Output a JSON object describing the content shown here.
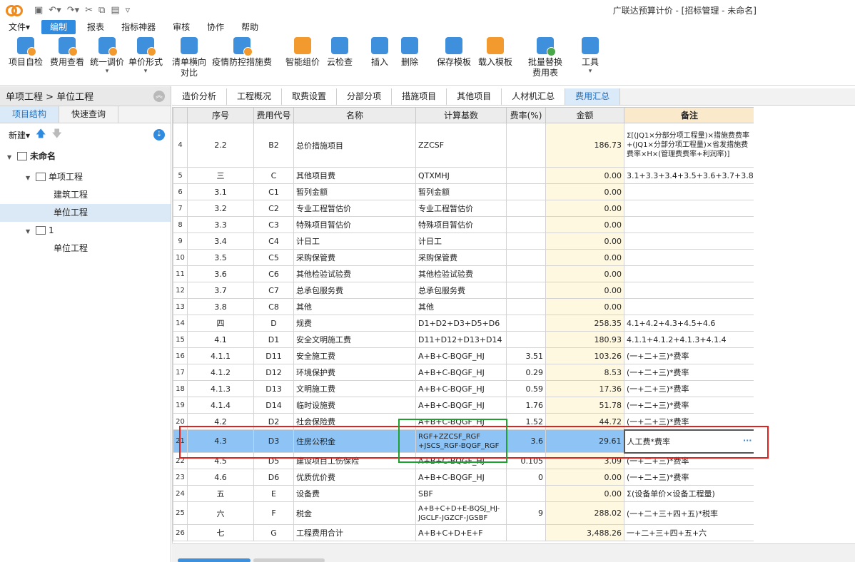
{
  "window": {
    "title": "广联达预算计价 - [招标管理 - 未命名]"
  },
  "menus": [
    "文件▾",
    "编制",
    "报表",
    "指标神器",
    "审核",
    "协作",
    "帮助"
  ],
  "ribbon": [
    {
      "label": "项目自检",
      "icon": "check-doc-icon"
    },
    {
      "label": "费用查看",
      "icon": "fee-view-icon"
    },
    {
      "label": "统一调价",
      "icon": "price-adjust-icon"
    },
    {
      "label": "单价形式",
      "icon": "unit-price-icon"
    },
    {
      "label": "清单横向\n对比",
      "icon": "compare-icon"
    },
    {
      "label": "疫情防控措施费",
      "icon": "epidemic-fee-icon"
    },
    {
      "label": "智能组价",
      "icon": "smart-price-icon"
    },
    {
      "label": "云检查",
      "icon": "cloud-check-icon"
    },
    {
      "label": "插入",
      "icon": "insert-icon"
    },
    {
      "label": "删除",
      "icon": "delete-icon"
    },
    {
      "label": "保存模板",
      "icon": "save-template-icon"
    },
    {
      "label": "载入模板",
      "icon": "load-template-icon"
    },
    {
      "label": "批量替换\n费用表",
      "icon": "batch-replace-icon"
    },
    {
      "label": "工具",
      "icon": "tools-icon"
    }
  ],
  "left": {
    "breadcrumb": "单项工程 > 单位工程",
    "tabs": [
      "项目结构",
      "快速查询"
    ],
    "new_label": "新建",
    "tree": [
      "未命名",
      "单项工程",
      "建筑工程",
      "单位工程",
      "1",
      "单位工程"
    ]
  },
  "tabs": [
    "造价分析",
    "工程概况",
    "取费设置",
    "分部分项",
    "措施项目",
    "其他项目",
    "人材机汇总",
    "费用汇总"
  ],
  "table": {
    "headers": [
      "",
      "序号",
      "费用代号",
      "名称",
      "计算基数",
      "费率(%)",
      "金额",
      "备注"
    ],
    "rows": [
      {
        "n": "4",
        "seq": "2.2",
        "code": "B2",
        "name": "总价措施项目",
        "base": "ZZCSF",
        "rate": "",
        "amt": "186.73",
        "note": "Σ[(JQ1×分部分项工程量)×措施费费率+(JQ1×分部分项工程量)×省发措施费费率×H×(管理费费率+利润率)]"
      },
      {
        "n": "5",
        "seq": "三",
        "code": "C",
        "name": "其他项目费",
        "base": "QTXMHJ",
        "rate": "",
        "amt": "0.00",
        "note": "3.1+3.3+3.4+3.5+3.6+3.7+3.8"
      },
      {
        "n": "6",
        "seq": "3.1",
        "code": "C1",
        "name": "暂列金额",
        "base": "暂列金额",
        "rate": "",
        "amt": "0.00",
        "note": ""
      },
      {
        "n": "7",
        "seq": "3.2",
        "code": "C2",
        "name": "专业工程暂估价",
        "base": "专业工程暂估价",
        "rate": "",
        "amt": "0.00",
        "note": ""
      },
      {
        "n": "8",
        "seq": "3.3",
        "code": "C3",
        "name": "特殊项目暂估价",
        "base": "特殊项目暂估价",
        "rate": "",
        "amt": "0.00",
        "note": ""
      },
      {
        "n": "9",
        "seq": "3.4",
        "code": "C4",
        "name": "计日工",
        "base": "计日工",
        "rate": "",
        "amt": "0.00",
        "note": ""
      },
      {
        "n": "10",
        "seq": "3.5",
        "code": "C5",
        "name": "采购保管费",
        "base": "采购保管费",
        "rate": "",
        "amt": "0.00",
        "note": ""
      },
      {
        "n": "11",
        "seq": "3.6",
        "code": "C6",
        "name": "其他检验试验费",
        "base": "其他检验试验费",
        "rate": "",
        "amt": "0.00",
        "note": ""
      },
      {
        "n": "12",
        "seq": "3.7",
        "code": "C7",
        "name": "总承包服务费",
        "base": "总承包服务费",
        "rate": "",
        "amt": "0.00",
        "note": ""
      },
      {
        "n": "13",
        "seq": "3.8",
        "code": "C8",
        "name": "其他",
        "base": "其他",
        "rate": "",
        "amt": "0.00",
        "note": ""
      },
      {
        "n": "14",
        "seq": "四",
        "code": "D",
        "name": "规费",
        "base": "D1+D2+D3+D5+D6",
        "rate": "",
        "amt": "258.35",
        "note": "4.1+4.2+4.3+4.5+4.6"
      },
      {
        "n": "15",
        "seq": "4.1",
        "code": "D1",
        "name": "安全文明施工费",
        "base": "D11+D12+D13+D14",
        "rate": "",
        "amt": "180.93",
        "note": "4.1.1+4.1.2+4.1.3+4.1.4"
      },
      {
        "n": "16",
        "seq": "4.1.1",
        "code": "D11",
        "name": "安全施工费",
        "base": "A+B+C-BQGF_HJ",
        "rate": "3.51",
        "amt": "103.26",
        "note": "(一+二+三)*费率"
      },
      {
        "n": "17",
        "seq": "4.1.2",
        "code": "D12",
        "name": "环境保护费",
        "base": "A+B+C-BQGF_HJ",
        "rate": "0.29",
        "amt": "8.53",
        "note": "(一+二+三)*费率"
      },
      {
        "n": "18",
        "seq": "4.1.3",
        "code": "D13",
        "name": "文明施工费",
        "base": "A+B+C-BQGF_HJ",
        "rate": "0.59",
        "amt": "17.36",
        "note": "(一+二+三)*费率"
      },
      {
        "n": "19",
        "seq": "4.1.4",
        "code": "D14",
        "name": "临时设施费",
        "base": "A+B+C-BQGF_HJ",
        "rate": "1.76",
        "amt": "51.78",
        "note": "(一+二+三)*费率"
      },
      {
        "n": "20",
        "seq": "4.2",
        "code": "D2",
        "name": "社会保险费",
        "base": "A+B+C-BQGF_HJ",
        "rate": "1.52",
        "amt": "44.72",
        "note": "(一+二+三)*费率"
      },
      {
        "n": "21",
        "seq": "4.3",
        "code": "D3",
        "name": "住房公积金",
        "base": "RGF+ZZCSF_RGF +JSCS_RGF-BQGF_RGF",
        "rate": "3.6",
        "amt": "29.61",
        "note": "人工费*费率"
      },
      {
        "n": "22",
        "seq": "4.5",
        "code": "D5",
        "name": "建设项目工伤保险",
        "base": "A+B+C-BQGF_HJ",
        "rate": "0.105",
        "amt": "3.09",
        "note": "(一+二+三)*费率"
      },
      {
        "n": "23",
        "seq": "4.6",
        "code": "D6",
        "name": "优质优价费",
        "base": "A+B+C-BQGF_HJ",
        "rate": "0",
        "amt": "0.00",
        "note": "(一+二+三)*费率"
      },
      {
        "n": "24",
        "seq": "五",
        "code": "E",
        "name": "设备费",
        "base": "SBF",
        "rate": "",
        "amt": "0.00",
        "note": "Σ(设备单价×设备工程量)"
      },
      {
        "n": "25",
        "seq": "六",
        "code": "F",
        "name": "税金",
        "base": "A+B+C+D+E-BQSJ_HJ-JGCLF-JGZCF-JGSBF",
        "rate": "9",
        "amt": "288.02",
        "note": "(一+二+三+四+五)*税率"
      },
      {
        "n": "26",
        "seq": "七",
        "code": "G",
        "name": "工程费用合计",
        "base": "A+B+C+D+E+F",
        "rate": "",
        "amt": "3,488.26",
        "note": "一+二+三+四+五+六"
      }
    ]
  }
}
